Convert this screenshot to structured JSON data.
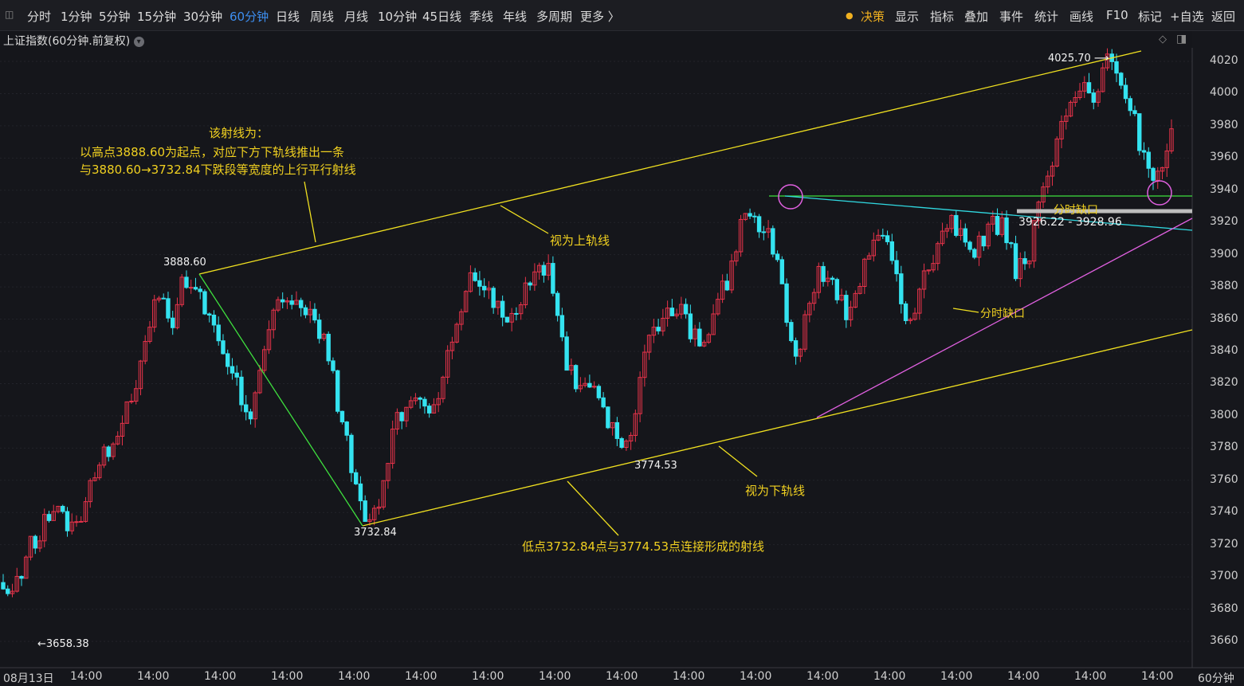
{
  "toolbar": {
    "left_items": [
      "分时",
      "1分钟",
      "5分钟",
      "15分钟",
      "30分钟",
      "60分钟",
      "日线",
      "周线",
      "月线",
      "10分钟",
      "45日线",
      "季线",
      "年线",
      "多周期",
      "更多 〉"
    ],
    "active": "60分钟",
    "right_items": [
      "决策",
      "显示",
      "指标",
      "叠加",
      "事件",
      "统计",
      "画线",
      "F10",
      "标记",
      "+自选",
      "返回"
    ]
  },
  "chart_title": "上证指数(60分钟.前复权)",
  "period_label": "60分钟",
  "colors": {
    "up": "#e8334a",
    "down": "#34e3f0",
    "yellow": "#f0e020",
    "green": "#3ee03e",
    "pink": "#e060e0",
    "cyan": "#30d8e0"
  },
  "chart_data": {
    "type": "candlestick",
    "y_ticks": [
      3660,
      3680,
      3700,
      3720,
      3740,
      3760,
      3780,
      3800,
      3820,
      3840,
      3860,
      3880,
      3900,
      3920,
      3940,
      3960,
      3980,
      4000,
      4020
    ],
    "ylim": [
      3650,
      4032
    ],
    "x_ticks": [
      "08月13日",
      "14:00",
      "14:00",
      "14:00",
      "14:00",
      "14:00",
      "14:00",
      "14:00",
      "14:00",
      "14:00",
      "14:00",
      "14:00",
      "14:00",
      "14:00",
      "14:00",
      "14:00",
      "14:00",
      "14:00"
    ],
    "key_points": [
      {
        "label": "3658.38",
        "value": 3658.38
      },
      {
        "label": "3888.60",
        "value": 3888.6
      },
      {
        "label": "3732.84",
        "value": 3732.84
      },
      {
        "label": "3774.53",
        "value": 3774.53
      },
      {
        "label": "4025.70",
        "value": 4025.7
      }
    ],
    "gap_label": "3926.22 - 3928.96",
    "anchors": [
      3690,
      3692,
      3718,
      3730,
      3745,
      3732,
      3738,
      3760,
      3780,
      3790,
      3815,
      3852,
      3875,
      3860,
      3885,
      3878,
      3858,
      3835,
      3818,
      3800,
      3840,
      3875,
      3870,
      3865,
      3858,
      3840,
      3800,
      3760,
      3733,
      3745,
      3790,
      3805,
      3815,
      3800,
      3830,
      3855,
      3890,
      3880,
      3870,
      3860,
      3875,
      3895,
      3893,
      3845,
      3820,
      3825,
      3812,
      3790,
      3778,
      3820,
      3855,
      3860,
      3868,
      3852,
      3843,
      3872,
      3885,
      3930,
      3918,
      3912,
      3880,
      3830,
      3870,
      3890,
      3883,
      3860,
      3878,
      3913,
      3914,
      3878,
      3855,
      3888,
      3905,
      3918,
      3912,
      3902,
      3920,
      3918,
      3890,
      3892,
      3946,
      3962,
      3988,
      4005,
      3998,
      4020,
      4012,
      3990,
      3955,
      3946,
      3972
    ]
  },
  "annotations": {
    "ray_desc_1": "该射线为：",
    "ray_desc_2": "以高点3888.60为起点，对应下方下轨线推出一条",
    "ray_desc_3": "与3880.60→3732.84下跌段等宽度的上行平行射线",
    "upper_rail": "视为上轨线",
    "lower_rail": "视为下轨线",
    "low_ray": "低点3732.84点与3774.53点连接形成的射线",
    "gap_top": "分时缺口",
    "gap_mid": "分时缺口"
  }
}
